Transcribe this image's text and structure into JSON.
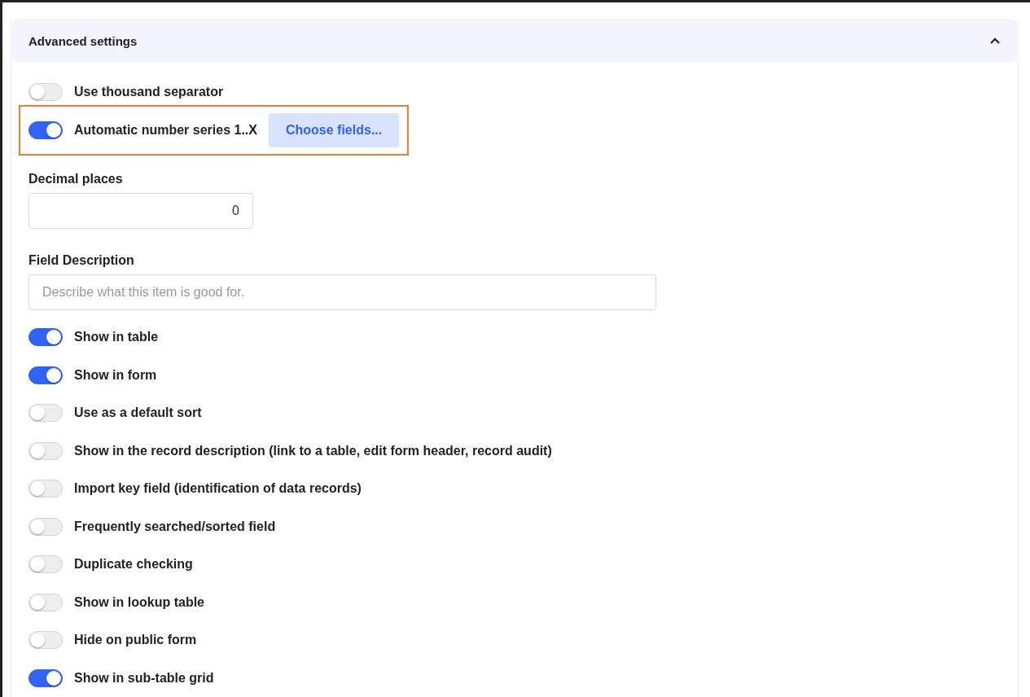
{
  "section": {
    "title": "Advanced settings",
    "expanded": true
  },
  "top_options": [
    {
      "label": "Use thousand separator",
      "on": false
    },
    {
      "label": "Automatic number series 1..X",
      "on": true,
      "highlighted": true,
      "button": "Choose fields..."
    }
  ],
  "decimal_places": {
    "label": "Decimal places",
    "value": "0"
  },
  "field_description": {
    "label": "Field Description",
    "placeholder": "Describe what this item is good for."
  },
  "options": [
    {
      "label": "Show in table",
      "on": true
    },
    {
      "label": "Show in form",
      "on": true
    },
    {
      "label": "Use as a default sort",
      "on": false
    },
    {
      "label": "Show in the record description (link to a table, edit form header, record audit)",
      "on": false
    },
    {
      "label": "Import key field (identification of data records)",
      "on": false
    },
    {
      "label": "Frequently searched/sorted field",
      "on": false
    },
    {
      "label": "Duplicate checking",
      "on": false
    },
    {
      "label": "Show in lookup table",
      "on": false
    },
    {
      "label": "Hide on public form",
      "on": false
    },
    {
      "label": "Show in sub-table grid",
      "on": true
    }
  ]
}
